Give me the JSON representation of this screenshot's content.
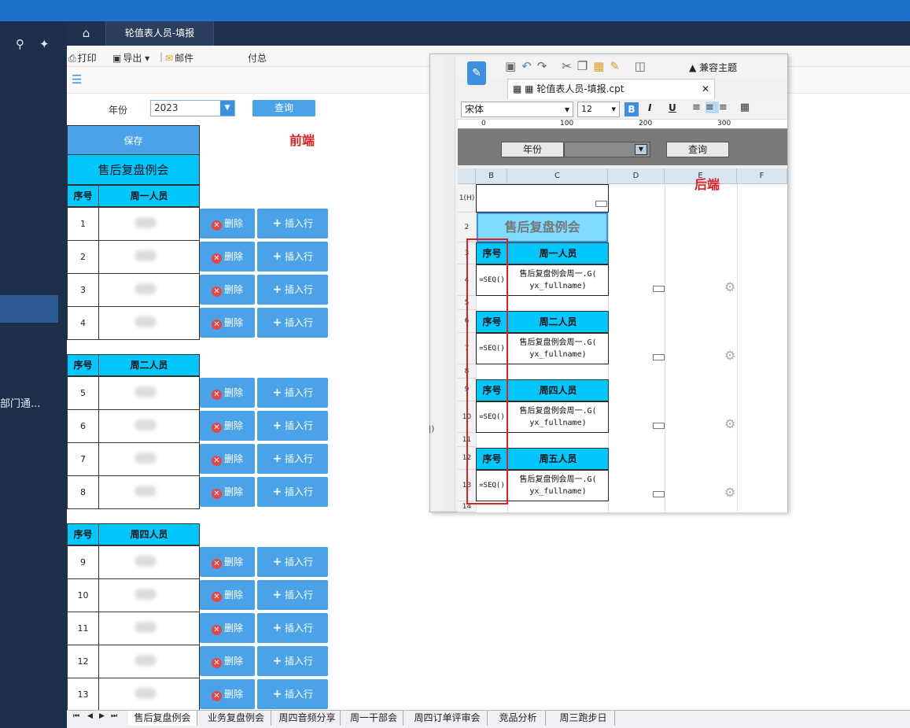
{
  "tabs": {
    "home_icon": "home-icon",
    "active": "轮值表人员-填报"
  },
  "sidebar": {
    "dept_text": "部门通..."
  },
  "toolbar": {
    "print": "打印",
    "export": "导出",
    "mail": "邮件",
    "pay": "付总"
  },
  "filter": {
    "label": "年份",
    "value": "2023",
    "query_button": "查询"
  },
  "form": {
    "save": "保存",
    "title": "售后复盘例会",
    "col_seq": "序号",
    "delete_label": "删除",
    "insert_label": "插入行",
    "sections": [
      {
        "header": "周一人员",
        "rows": [
          "1",
          "2",
          "3",
          "4"
        ]
      },
      {
        "header": "周二人员",
        "rows": [
          "5",
          "6",
          "7",
          "8"
        ]
      },
      {
        "header": "周四人员",
        "rows": [
          "9",
          "10",
          "11",
          "12",
          "13"
        ]
      }
    ]
  },
  "annotations": {
    "frontend": "前端",
    "backend": "后端"
  },
  "designer": {
    "theme_button": "兼容主题",
    "file_tab": "轮值表人员-填报.cpt",
    "font": "宋体",
    "size": "12",
    "ruler": [
      "0",
      "100",
      "200",
      "300"
    ],
    "param_label": "年份",
    "param_query": "查询",
    "col_headers": [
      "B",
      "C",
      "D",
      "E",
      "F"
    ],
    "row_headers": [
      "1(H)",
      "2",
      "3",
      "4",
      "5",
      "6",
      "7",
      "8",
      "9",
      "10",
      "11",
      "12",
      "13",
      "14"
    ],
    "title": "售后复盘例会",
    "seq_label": "序号",
    "seq_formula": "=SEQ()",
    "data_formula_line1": "售后复盘例会周一.G(",
    "data_formula_line2": "yx_fullname)",
    "groups": [
      "周一人员",
      "周二人员",
      "周四人员",
      "周五人员"
    ],
    "left_fragment": "|)"
  },
  "sheets": [
    "售后复盘例会",
    "业务复盘例会",
    "周四音频分享",
    "周一干部会",
    "周四订单评审会",
    "竞品分析",
    "周三跑步日"
  ],
  "colors": {
    "accent": "#4aa3e8",
    "header_cyan": "#00c8ff",
    "top_blue": "#1f72c9",
    "sidebar": "#1e2f4e",
    "annotation_red": "#e02020"
  }
}
